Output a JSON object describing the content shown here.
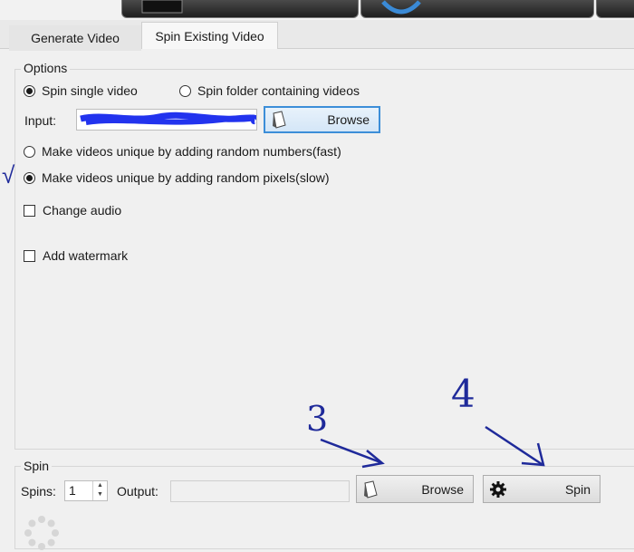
{
  "tabs": [
    {
      "label": "Generate Video",
      "active": false
    },
    {
      "label": "Spin Existing Video",
      "active": true
    }
  ],
  "options": {
    "group_label": "Options",
    "mode_single_label": "Spin single video",
    "mode_folder_label": "Spin folder containing videos",
    "mode_selected": "single",
    "input_label": "Input:",
    "input_value": "",
    "browse_label": "Browse",
    "unique_numbers_label": "Make videos unique by adding random numbers(fast)",
    "unique_pixels_label": "Make videos unique by adding random pixels(slow)",
    "unique_selected": "pixels",
    "change_audio_label": "Change audio",
    "change_audio_checked": false,
    "add_watermark_label": "Add watermark",
    "add_watermark_checked": false
  },
  "spin": {
    "group_label": "Spin",
    "spins_label": "Spins:",
    "spins_value": "1",
    "output_label": "Output:",
    "output_value": "",
    "browse_label": "Browse",
    "spin_label": "Spin"
  },
  "annotations": {
    "checkmark": "√",
    "step3": "3",
    "step4": "4"
  },
  "colors": {
    "accent_border": "#3c8ed8",
    "ink": "#1f2a9a",
    "redaction": "#2233ee"
  },
  "icons": [
    "page-icon",
    "gear-icon",
    "loading-spinner-icon"
  ]
}
